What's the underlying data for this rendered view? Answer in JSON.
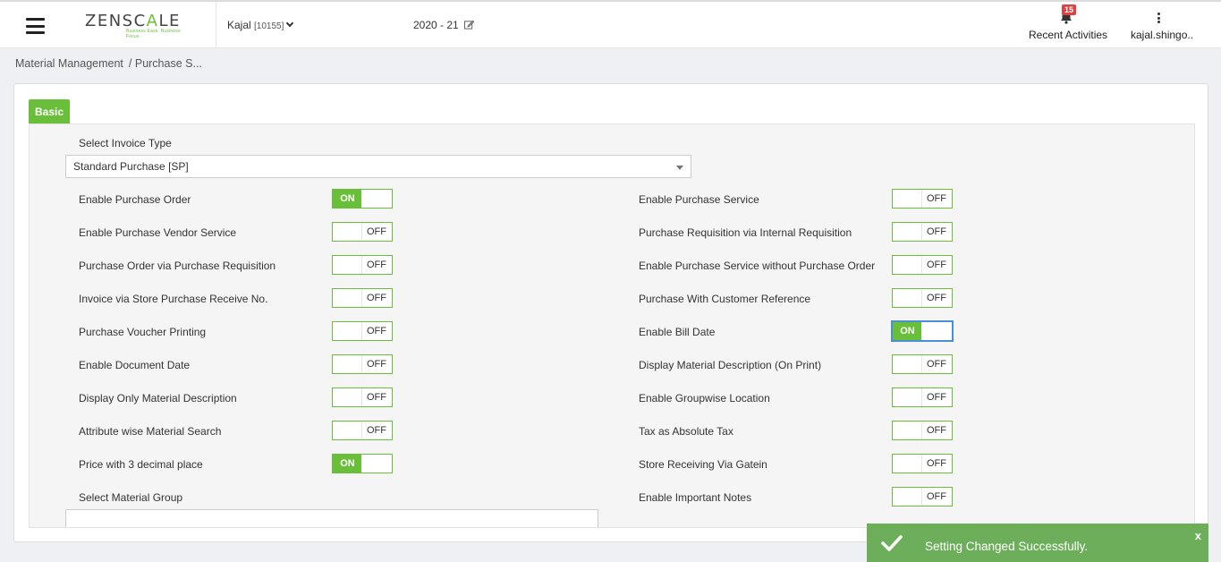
{
  "header": {
    "logo_text_a": "ZENSC",
    "logo_text_o": "A",
    "logo_text_b": "LE",
    "logo_tagline": "Business Ease. Business Focus.",
    "user_name": "Kajal",
    "user_code": "[10155]",
    "year": "2020 - 21",
    "notifications_count": "15",
    "recent_label": "Recent Activities",
    "username": "kajal.shingo.."
  },
  "breadcrumb": {
    "root": "Material Management",
    "current": "/ Purchase S..."
  },
  "tabs": {
    "basic": "Basic"
  },
  "form": {
    "invoice_type_label": "Select Invoice Type",
    "invoice_type_value": "Standard Purchase [SP]",
    "material_group_label": "Select Material Group",
    "on_label": "ON",
    "off_label": "OFF",
    "left": [
      {
        "label": "Enable Purchase Order",
        "state": "ON"
      },
      {
        "label": "Enable Purchase Vendor Service",
        "state": "OFF"
      },
      {
        "label": "Purchase Order via Purchase Requisition",
        "state": "OFF"
      },
      {
        "label": "Invoice via Store Purchase Receive No.",
        "state": "OFF"
      },
      {
        "label": "Purchase Voucher Printing",
        "state": "OFF"
      },
      {
        "label": "Enable Document Date",
        "state": "OFF"
      },
      {
        "label": "Display Only Material Description",
        "state": "OFF"
      },
      {
        "label": "Attribute wise Material Search",
        "state": "OFF"
      },
      {
        "label": "Price with 3 decimal place",
        "state": "ON"
      }
    ],
    "right": [
      {
        "label": "Enable Purchase Service",
        "state": "OFF"
      },
      {
        "label": "Purchase Requisition via Internal Requisition",
        "state": "OFF"
      },
      {
        "label": "Enable Purchase Service without Purchase Order",
        "state": "OFF"
      },
      {
        "label": "Purchase With Customer Reference",
        "state": "OFF"
      },
      {
        "label": "Enable Bill Date",
        "state": "ON"
      },
      {
        "label": "Display Material Description (On Print)",
        "state": "OFF"
      },
      {
        "label": "Enable Groupwise Location",
        "state": "OFF"
      },
      {
        "label": "Tax as Absolute Tax",
        "state": "OFF"
      },
      {
        "label": "Store Receiving Via Gatein",
        "state": "OFF"
      },
      {
        "label": "Enable Important Notes",
        "state": "OFF"
      }
    ]
  },
  "toast": {
    "message": "Setting Changed Successfully.",
    "close": "x"
  },
  "colors": {
    "accent": "#6abf3a",
    "toast": "#6dae5b"
  }
}
